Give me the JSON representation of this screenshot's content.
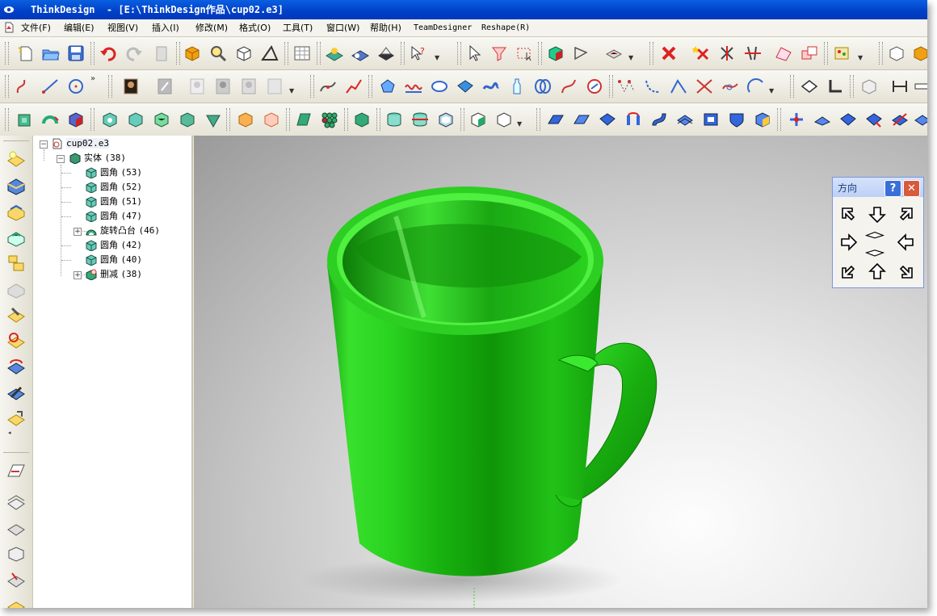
{
  "window": {
    "title": "ThinkDesign  - [E:\\ThinkDesign作品\\cup02.e3]"
  },
  "menu": [
    {
      "label": "文件(F)"
    },
    {
      "label": "编辑(E)"
    },
    {
      "label": "视图(V)"
    },
    {
      "label": "插入(I)"
    },
    {
      "label": "修改(M)"
    },
    {
      "label": "格式(O)"
    },
    {
      "label": "工具(T)"
    },
    {
      "label": "窗口(W)"
    },
    {
      "label": "帮助(H)"
    },
    {
      "label": "TeamDesigner"
    },
    {
      "label": "Reshape(R)"
    }
  ],
  "tree": {
    "root": "cup02.e3",
    "solid": {
      "name": "实体",
      "count": "(38)"
    },
    "items": [
      {
        "name": "圆角",
        "count": "(53)"
      },
      {
        "name": "圆角",
        "count": "(52)"
      },
      {
        "name": "圆角",
        "count": "(51)"
      },
      {
        "name": "圆角",
        "count": "(47)"
      },
      {
        "name": "旋转凸台",
        "count": "(46)"
      },
      {
        "name": "圆角",
        "count": "(42)"
      },
      {
        "name": "圆角",
        "count": "(40)"
      },
      {
        "name": "删减",
        "count": "(38)"
      }
    ]
  },
  "direction_panel": {
    "title": "方向",
    "help_label": "?",
    "close_label": "✕"
  },
  "colors": {
    "mug": "#22d41a",
    "titlebar": "#0a5fe0",
    "panel_header": "#bcd0f6"
  }
}
